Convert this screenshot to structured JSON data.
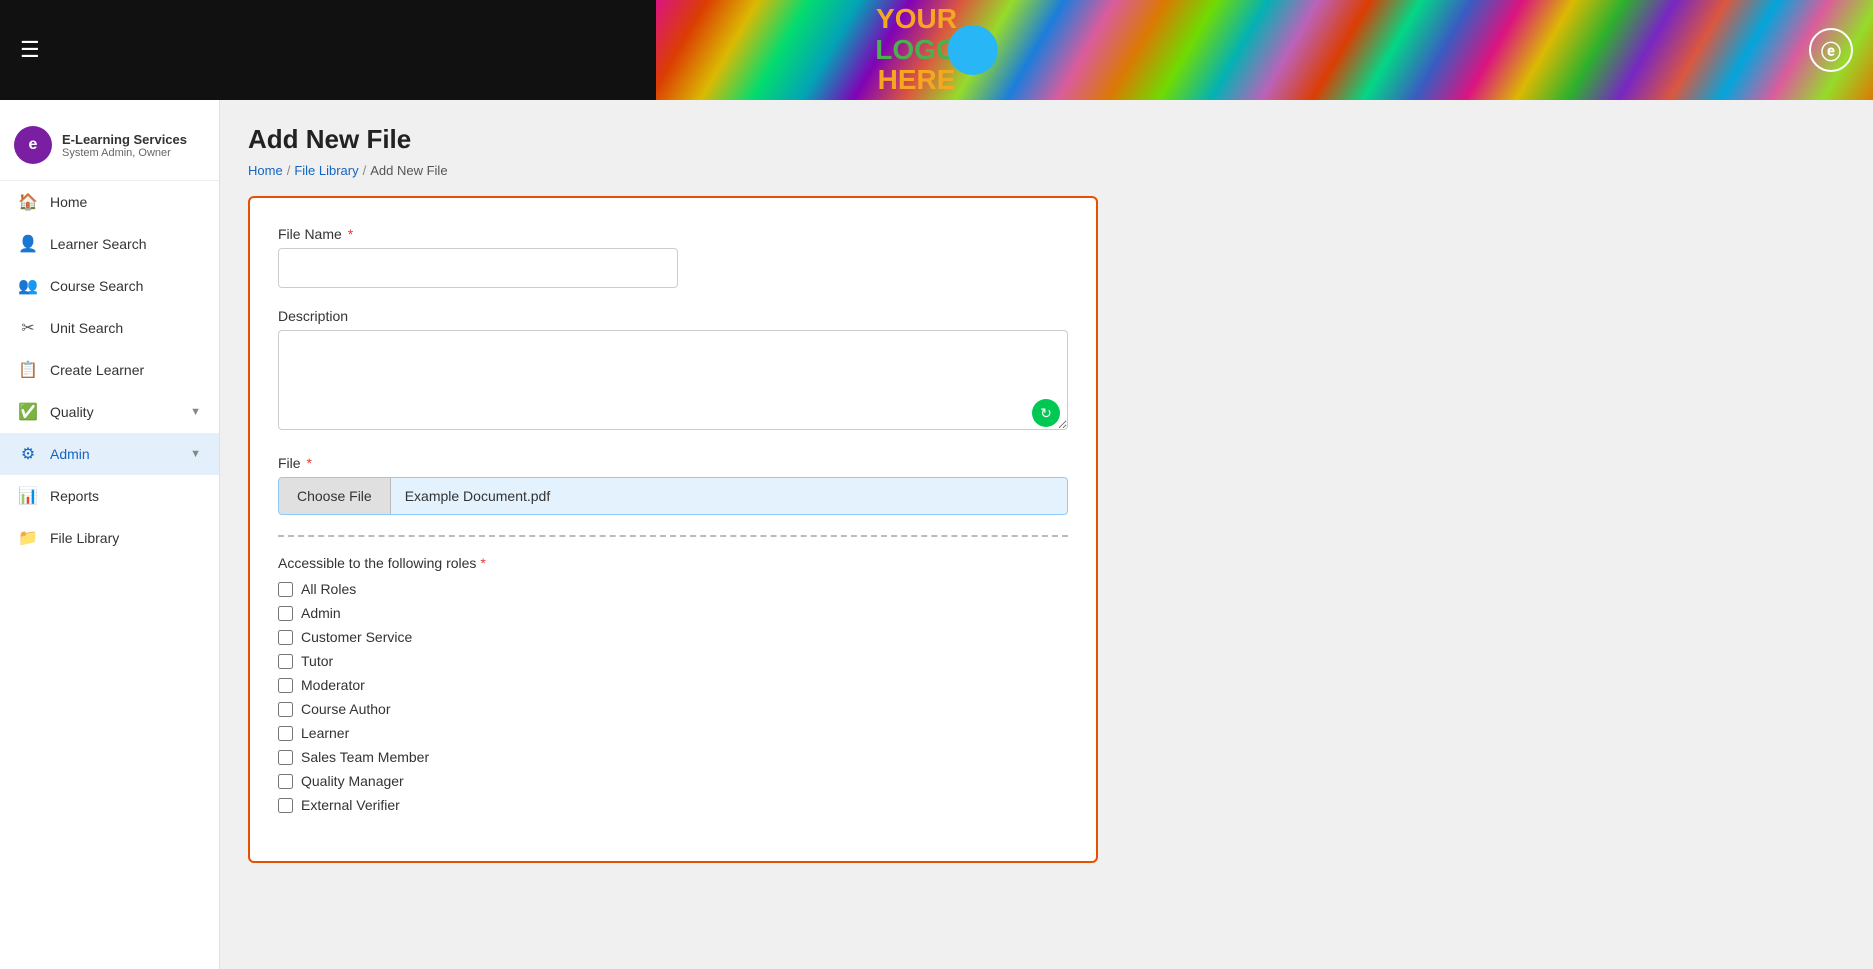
{
  "header": {
    "hamburger_label": "☰",
    "logo_line1": "YOUR",
    "logo_line2": "LOGO",
    "logo_line3": "HERE",
    "header_icon": "ⓔ"
  },
  "sidebar": {
    "user_name": "E-Learning Services",
    "user_role": "System Admin, Owner",
    "user_avatar_letter": "e",
    "nav_items": [
      {
        "id": "home",
        "label": "Home",
        "icon": "🏠"
      },
      {
        "id": "learner-search",
        "label": "Learner Search",
        "icon": "👤"
      },
      {
        "id": "course-search",
        "label": "Course Search",
        "icon": "👥"
      },
      {
        "id": "unit-search",
        "label": "Unit Search",
        "icon": "✂"
      },
      {
        "id": "create-learner",
        "label": "Create Learner",
        "icon": "📋"
      },
      {
        "id": "quality",
        "label": "Quality",
        "icon": "✅",
        "has_chevron": true
      },
      {
        "id": "admin",
        "label": "Admin",
        "icon": "⚙",
        "has_chevron": true,
        "active": true
      },
      {
        "id": "reports",
        "label": "Reports",
        "icon": "📊"
      },
      {
        "id": "file-library",
        "label": "File Library",
        "icon": "📁"
      }
    ]
  },
  "page": {
    "title": "Add New File",
    "breadcrumbs": [
      {
        "label": "Home",
        "href": "#"
      },
      {
        "label": "File Library",
        "href": "#"
      },
      {
        "label": "Add New File",
        "href": null
      }
    ]
  },
  "form": {
    "file_name_label": "File Name",
    "file_name_placeholder": "",
    "description_label": "Description",
    "file_label": "File",
    "choose_file_btn": "Choose File",
    "file_selected": "Example Document.pdf",
    "accessible_roles_label": "Accessible to the following roles",
    "roles": [
      "All Roles",
      "Admin",
      "Customer Service",
      "Tutor",
      "Moderator",
      "Course Author",
      "Learner",
      "Sales Team Member",
      "Quality Manager",
      "External Verifier"
    ],
    "required_marker": "*"
  }
}
